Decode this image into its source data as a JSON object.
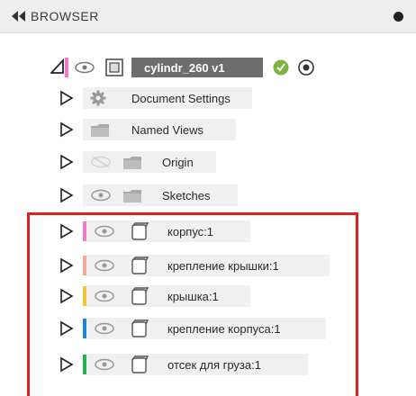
{
  "browser": {
    "title": "BROWSER",
    "root": {
      "name": "cylindr_260 v1"
    },
    "folders": [
      {
        "label": "Document Settings",
        "icon": "gear-icon"
      },
      {
        "label": "Named Views",
        "icon": "folder-icon"
      },
      {
        "label": "Origin",
        "icon": "folder-icon",
        "hidden": true
      },
      {
        "label": "Sketches",
        "icon": "folder-icon"
      }
    ],
    "components": [
      {
        "label": "корпус:1",
        "color": "#f07ac8"
      },
      {
        "label": "крепление крышки:1",
        "color": "#f3a79a"
      },
      {
        "label": "крышка:1",
        "color": "#f2c43b"
      },
      {
        "label": "крепление корпуса:1",
        "color": "#1f86d8"
      },
      {
        "label": "отсек для груза:1",
        "color": "#22b14c"
      }
    ]
  },
  "colors": {
    "highlight_box": "#e02020",
    "root_badge": "#7cb342"
  }
}
